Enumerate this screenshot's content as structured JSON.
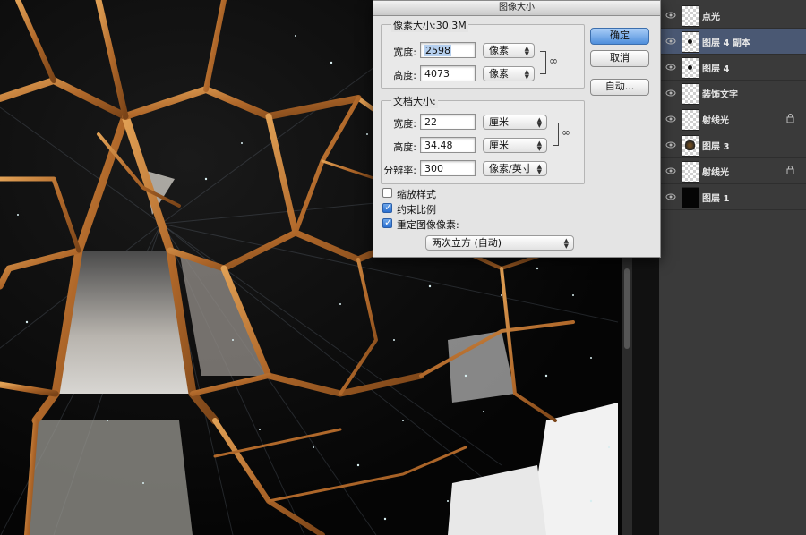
{
  "dialog": {
    "title": "图像大小",
    "pixel_dimensions": {
      "title": "像素大小:30.3M",
      "width_label": "宽度:",
      "width_value": "2598",
      "width_unit": "像素",
      "height_label": "高度:",
      "height_value": "4073",
      "height_unit": "像素"
    },
    "document_size": {
      "title": "文档大小:",
      "width_label": "宽度:",
      "width_value": "22",
      "width_unit": "厘米",
      "height_label": "高度:",
      "height_value": "34.48",
      "height_unit": "厘米",
      "resolution_label": "分辨率:",
      "resolution_value": "300",
      "resolution_unit": "像素/英寸"
    },
    "options": {
      "scale_styles": {
        "label": "缩放样式",
        "checked": false
      },
      "constrain_proportions": {
        "label": "约束比例",
        "checked": true
      },
      "resample_image": {
        "label": "重定图像像素:",
        "checked": true
      },
      "resample_method": "两次立方 (自动)"
    },
    "buttons": {
      "ok": "确定",
      "cancel": "取消",
      "auto": "自动..."
    }
  },
  "layers": [
    {
      "name": "点光",
      "thumb": "transparent",
      "locked": false,
      "selected": false
    },
    {
      "name": "图层 4 副本",
      "thumb": "dot",
      "locked": false,
      "selected": true
    },
    {
      "name": "图层 4",
      "thumb": "dot",
      "locked": false,
      "selected": false
    },
    {
      "name": "装饰文字",
      "thumb": "transparent",
      "locked": false,
      "selected": false
    },
    {
      "name": "射线光",
      "thumb": "transparent",
      "locked": true,
      "selected": false
    },
    {
      "name": "图层 3",
      "thumb": "blob",
      "locked": false,
      "selected": false
    },
    {
      "name": "射线光",
      "thumb": "transparent",
      "locked": true,
      "selected": false
    },
    {
      "name": "图层 1",
      "thumb": "black",
      "locked": false,
      "selected": false
    }
  ],
  "colors": {
    "frame_gold": "#c8843a",
    "selected_layer": "#4a5873",
    "panel_bg": "#3a3a3a",
    "primary_button": "#4f8fdc"
  }
}
